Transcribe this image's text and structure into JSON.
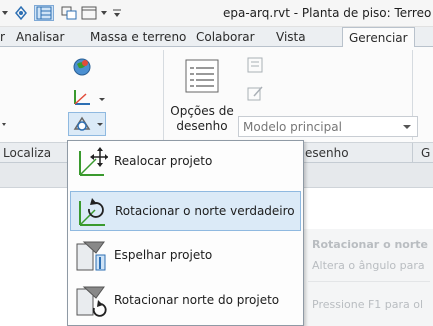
{
  "window": {
    "title": "epa-arq.rvt - Planta de piso: Terreo"
  },
  "tabs": [
    {
      "label": "r"
    },
    {
      "label": "Analisar"
    },
    {
      "label": "Massa e terreno"
    },
    {
      "label": "Colaborar"
    },
    {
      "label": "Vista"
    },
    {
      "label": "Gerenciar"
    }
  ],
  "ribbon": {
    "drawing_options_label": "Opções de desenho",
    "drawing_options_line1": "Opções de",
    "drawing_options_line2": "desenho",
    "model_combo_value": "Modelo principal",
    "panel_labels": [
      "Localiza",
      "esenho",
      "G"
    ]
  },
  "menu": {
    "items": [
      {
        "label": "Realocar projeto",
        "icon": "relocate-project-icon"
      },
      {
        "label": "Rotacionar o norte verdadeiro",
        "icon": "rotate-true-north-icon",
        "highlighted": true
      },
      {
        "label": "Espelhar projeto",
        "icon": "mirror-project-icon"
      },
      {
        "label": "Rotacionar norte do projeto",
        "icon": "rotate-project-north-icon"
      }
    ]
  },
  "tooltip": {
    "title": "Rotacionar o norte",
    "description": "Altera o ângulo para",
    "hint": "Pressione F1 para ol"
  },
  "colors": {
    "menu_highlight": "#dbeaf7",
    "active_tab": "#fbfbfb",
    "icon_green": "#3a9a2e",
    "icon_blue": "#2d6fb3"
  }
}
